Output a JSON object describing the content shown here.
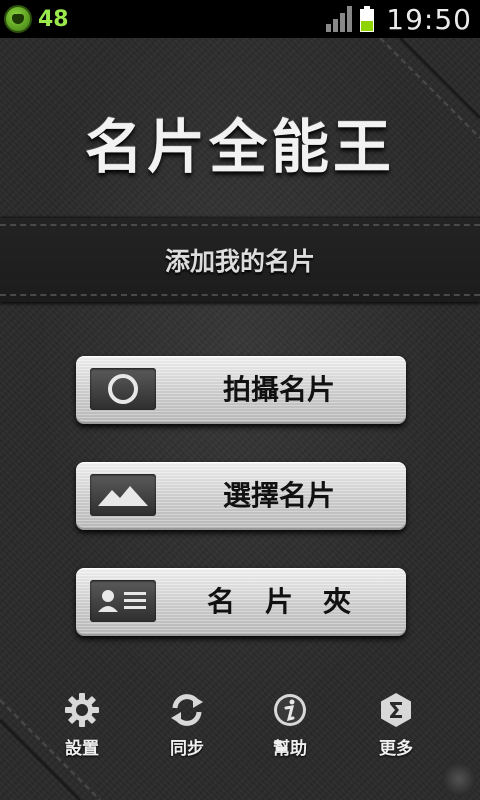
{
  "status_bar": {
    "notification_count": "48",
    "time": "19:50",
    "icons": [
      "app-notification-icon",
      "signal-icon",
      "battery-icon"
    ]
  },
  "app": {
    "title": "名片全能王",
    "add_card_label": "添加我的名片"
  },
  "actions": [
    {
      "label": "拍攝名片",
      "icon": "camera-icon"
    },
    {
      "label": "選擇名片",
      "icon": "image-icon"
    },
    {
      "label": "名片夾",
      "icon": "contact-card-icon"
    }
  ],
  "toolbar": [
    {
      "label": "設置",
      "icon": "gear-icon"
    },
    {
      "label": "同步",
      "icon": "sync-icon"
    },
    {
      "label": "幫助",
      "icon": "info-icon"
    },
    {
      "label": "更多",
      "icon": "sigma-icon"
    }
  ],
  "colors": {
    "background": "#2a2a2a",
    "status_bar": "#000000",
    "notification_green": "#9be84d",
    "battery_green": "#8fd400",
    "button_text": "#111111"
  }
}
